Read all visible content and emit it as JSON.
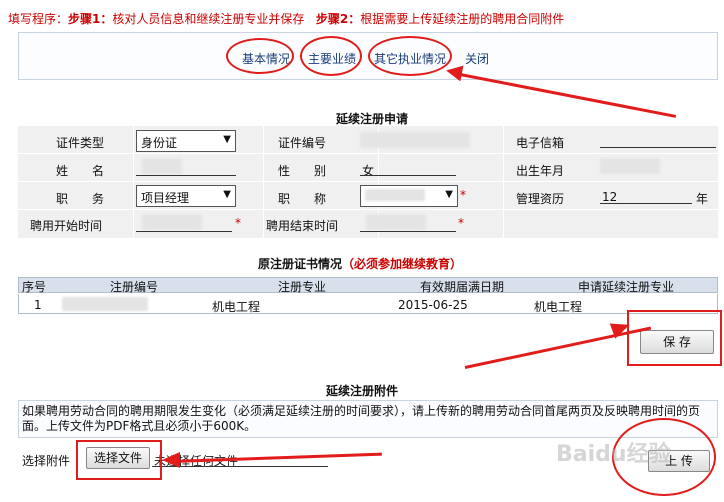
{
  "instructions": {
    "label": "填写程序：",
    "step1_tag": "步骤1：",
    "step1_text": "核对人员信息和继续注册专业并保存",
    "step2_tag": "步骤2：",
    "step2_text": "根据需要上传延续注册的聘用合同附件"
  },
  "nav": {
    "links": [
      "基本情况",
      "主要业绩",
      "其它执业情况",
      "关闭"
    ]
  },
  "form": {
    "title": "延续注册申请",
    "fields": {
      "id_type_label": "证件类型",
      "id_type_value": "身份证",
      "id_no_label": "证件编号",
      "email_label": "电子信箱",
      "name_label": "姓　　名",
      "gender_label": "性　　别",
      "gender_value": "女",
      "birth_label": "出生年月",
      "position_label": "职　　务",
      "position_value": "项目经理",
      "title_label": "职　　称",
      "mgmt_label": "管理资历",
      "mgmt_value": "12",
      "mgmt_unit": "年",
      "hire_start_label": "聘用开始时间",
      "hire_end_label": "聘用结束时间",
      "required_mark": "*"
    }
  },
  "cert": {
    "title": "原注册证书情况",
    "title_note": "（必须参加继续教育）",
    "columns": [
      "序号",
      "注册编号",
      "注册专业",
      "有效期届满日期",
      "申请延续注册专业"
    ],
    "rows": [
      {
        "index": "1",
        "reg_no": "",
        "specialty": "机电工程",
        "expiry": "2015-06-25",
        "renew_specialty": "机电工程"
      }
    ],
    "save_button": "保 存"
  },
  "attachment": {
    "title": "延续注册附件",
    "note": "如果聘用劳动合同的聘用期限发生变化（必须满足延续注册的时间要求），请上传新的聘用劳动合同首尾两页及反映聘用时间的页面。上传文件为PDF格式且必须小于600K。",
    "select_label": "选择附件",
    "choose_button": "选择文件",
    "no_file_text": "未选择任何文件",
    "upload_button": "上 传"
  },
  "watermark": "Baidu经验"
}
